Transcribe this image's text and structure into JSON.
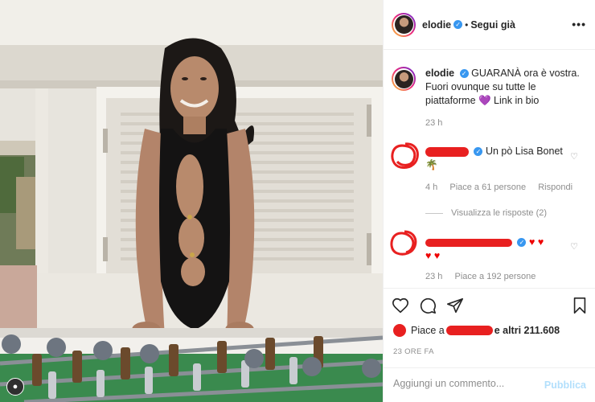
{
  "header": {
    "username": "elodie",
    "separator": "•",
    "follow_label": "Segui già",
    "more_icon": "more-icon"
  },
  "caption": {
    "username": "elodie",
    "text": "GUARANÀ ora è vostra. Fuori ovunque su tutte le piattaforme 💜 Link in bio",
    "time": "23 h"
  },
  "comments": [
    {
      "text": "Un pò Lisa Bonet",
      "emoji": "🌴",
      "time": "4 h",
      "likes": "Piace a 61 persone",
      "reply": "Rispondi",
      "view_replies": "Visualizza le risposte (2)"
    },
    {
      "text": "♥ ♥",
      "text2": "♥ ♥",
      "time": "23 h",
      "likes": "Piace a 192 persone"
    }
  ],
  "likes": {
    "prefix": "Piace a",
    "suffix": "e altri 211.608"
  },
  "post_time": "23 ORE FA",
  "add_comment": {
    "placeholder": "Aggiungi un commento...",
    "publish": "Pubblica"
  },
  "colors": {
    "accent_blue": "#3897f0",
    "redaction": "#e82020",
    "muted": "#8e8e8e"
  }
}
